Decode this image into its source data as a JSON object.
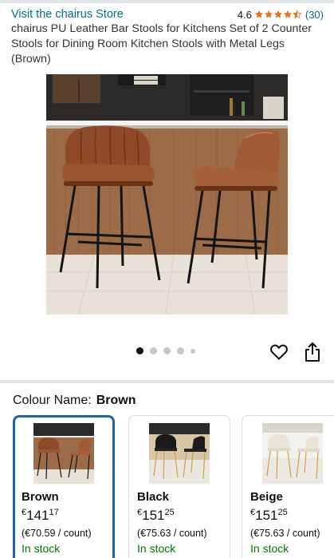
{
  "store": {
    "link_text": "Visit the chairus Store",
    "rating": "4.6",
    "stars": 4.5,
    "review_count": "(30)",
    "star_color": "#de7921"
  },
  "product": {
    "title": "chairus PU Leather Bar Stools for Kitchens Set of 2 Counter Stools for Dining Room Kitchen Stools with Metal Legs (Brown)",
    "image_count": 5,
    "active_image_index": 0
  },
  "colour": {
    "label": "Colour Name:",
    "selected": "Brown",
    "selected_border_color": "#2162a1",
    "options": [
      {
        "name": "Brown",
        "currency": "€",
        "whole": "141",
        "fraction": "17",
        "unit_price": "(€70.59 / count)",
        "availability": "In stock",
        "selected": true
      },
      {
        "name": "Black",
        "currency": "€",
        "whole": "151",
        "fraction": "25",
        "unit_price": "(€75.63 / count)",
        "availability": "In stock",
        "selected": false
      },
      {
        "name": "Beige",
        "currency": "€",
        "whole": "151",
        "fraction": "25",
        "unit_price": "(€75.63 / count)",
        "availability": "In stock",
        "selected": false
      }
    ]
  },
  "icons": {
    "wishlist": "heart-icon",
    "share": "share-icon"
  }
}
